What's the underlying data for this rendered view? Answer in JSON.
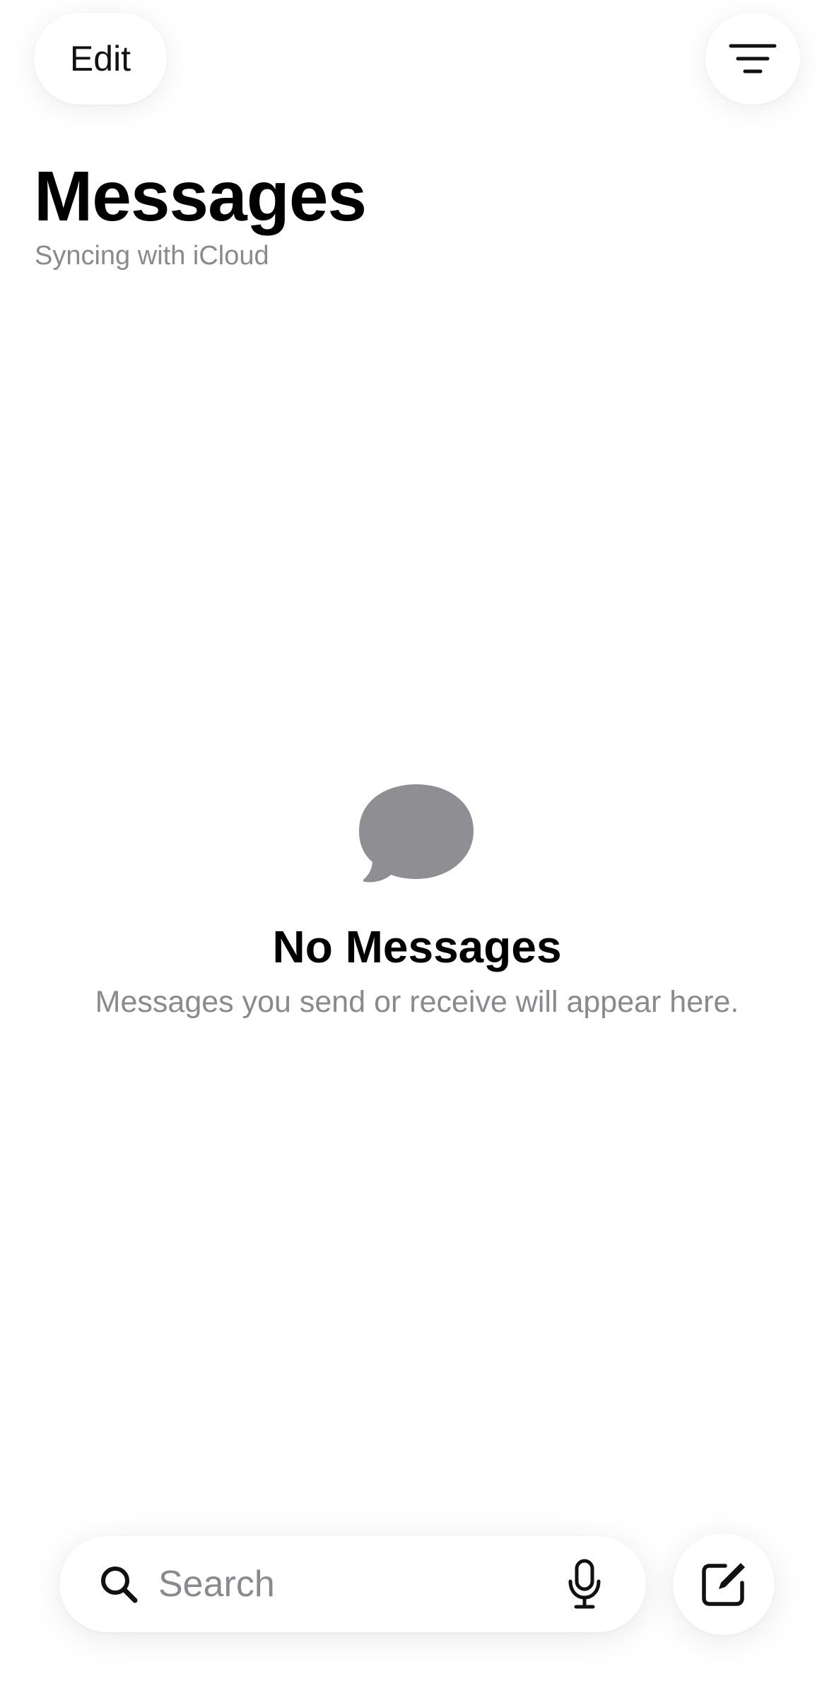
{
  "header": {
    "edit_label": "Edit",
    "filter_icon": "filter-lines-icon",
    "title": "Messages",
    "subtitle": "Syncing with iCloud"
  },
  "empty_state": {
    "icon": "message-bubble-icon",
    "icon_color": "#8e8e93",
    "title": "No Messages",
    "description": "Messages you send or receive will appear here."
  },
  "bottom_bar": {
    "search": {
      "placeholder": "Search",
      "value": "",
      "icon": "search-icon",
      "mic_icon": "microphone-icon"
    },
    "compose_icon": "compose-icon"
  },
  "colors": {
    "background": "#ffffff",
    "primary_text": "#000000",
    "secondary_text": "#8a8a8e"
  }
}
